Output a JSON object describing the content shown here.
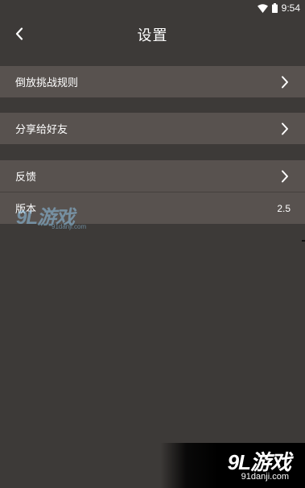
{
  "status_bar": {
    "time": "9:54",
    "icons": [
      "wifi-icon",
      "battery-icon"
    ]
  },
  "app_bar": {
    "title": "设置",
    "back_icon": "chevron-left-icon"
  },
  "settings": {
    "items": [
      {
        "label": "倒放挑战规则",
        "icon": "chevron-right-icon"
      },
      {
        "label": "分享给好友",
        "icon": "chevron-right-icon"
      },
      {
        "label": "反馈",
        "icon": "chevron-right-icon"
      },
      {
        "label": "版本",
        "value": "2.5"
      }
    ]
  },
  "watermark": {
    "logo_text": "9L游戏",
    "domain": "91danji.com"
  },
  "colors": {
    "background": "#3d3a38",
    "row_background": "#58524f",
    "text": "#ffffff"
  }
}
